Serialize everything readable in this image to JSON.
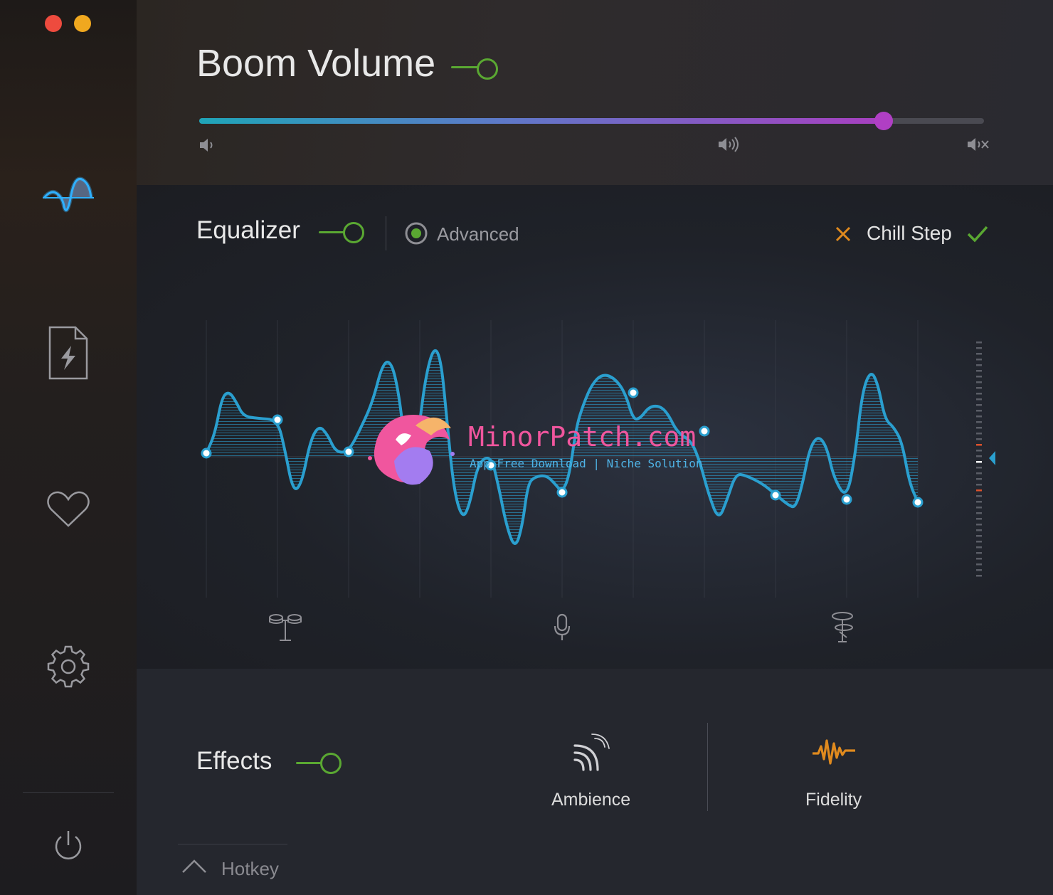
{
  "window": {
    "controls": [
      "close",
      "minimize"
    ]
  },
  "sidebar": {
    "items": [
      {
        "name": "equalizer",
        "icon": "sine-wave-icon",
        "active": true
      },
      {
        "name": "file",
        "icon": "file-bolt-icon"
      },
      {
        "name": "favorites",
        "icon": "heart-icon"
      },
      {
        "name": "settings",
        "icon": "gear-icon"
      }
    ],
    "power_icon": "power-icon"
  },
  "volume": {
    "title": "Boom Volume",
    "enabled": true,
    "level": 0.872,
    "icons": [
      "volume-low-icon",
      "volume-high-icon",
      "volume-boost-icon"
    ]
  },
  "equalizer": {
    "title": "Equalizer",
    "enabled": true,
    "advanced_label": "Advanced",
    "advanced_selected": true,
    "preset_name": "Chill Step",
    "cancel_icon": "x-icon",
    "confirm_icon": "check-icon",
    "band_icons": [
      "drums-icon",
      "microphone-icon",
      "cymbal-icon"
    ]
  },
  "effects": {
    "title": "Effects",
    "enabled": true,
    "items": [
      {
        "label": "Ambience",
        "icon": "ambience-icon"
      },
      {
        "label": "Fidelity",
        "icon": "fidelity-wave-icon"
      }
    ]
  },
  "hotkey": {
    "label": "Hotkey"
  },
  "watermark": {
    "title": "MinorPatch.com",
    "subtitle": "App Free Download | Niche Solution"
  },
  "colors": {
    "accent_green": "#5aa832",
    "eq_blue": "#2a9fcf",
    "orange": "#e08a1e",
    "slider_start": "#1fa5b8",
    "slider_end": "#a83fc0"
  }
}
